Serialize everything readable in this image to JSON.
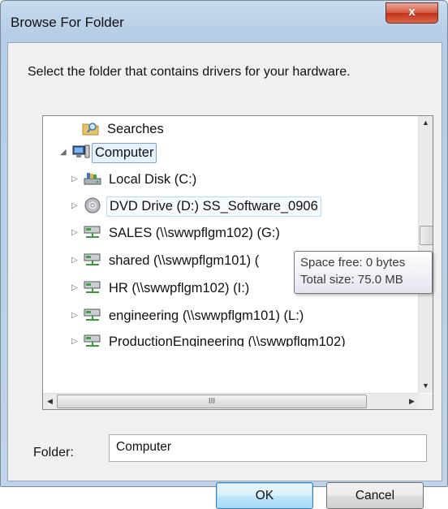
{
  "window": {
    "title": "Browse For Folder",
    "close_label": "x"
  },
  "instruction": "Select the folder that contains drivers for your hardware.",
  "tree": {
    "items": [
      {
        "label": "Searches",
        "icon": "folder-search-icon",
        "expander": "",
        "selected": false
      },
      {
        "label": "Computer",
        "icon": "computer-icon",
        "expander": "expanded",
        "selected": true
      },
      {
        "label": "Local Disk (C:)",
        "icon": "hard-disk-icon",
        "expander": "collapsed",
        "selected": false
      },
      {
        "label": "DVD Drive (D:) SS_Software_0906",
        "icon": "dvd-drive-icon",
        "expander": "collapsed",
        "selected": false,
        "hovered": true
      },
      {
        "label": "SALES (\\\\swwpflgm102) (G:)",
        "icon": "network-drive-icon",
        "expander": "collapsed",
        "selected": false
      },
      {
        "label": "shared (\\\\swwpflgm101) (",
        "icon": "network-drive-icon",
        "expander": "collapsed",
        "selected": false
      },
      {
        "label": "HR (\\\\swwpflgm102) (I:)",
        "icon": "network-drive-icon",
        "expander": "collapsed",
        "selected": false
      },
      {
        "label": "engineering (\\\\swwpflgm101) (L:)",
        "icon": "network-drive-icon",
        "expander": "collapsed",
        "selected": false
      },
      {
        "label": "ProductionEngineering (\\\\swwpflgm102)",
        "icon": "network-drive-icon",
        "expander": "collapsed",
        "selected": false
      }
    ]
  },
  "tooltip": {
    "line1": "Space free: 0 bytes",
    "line2": "Total size: 75.0 MB"
  },
  "scrollbar": {
    "hthumb_grip": "III"
  },
  "folder": {
    "label": "Folder:",
    "value": "Computer"
  },
  "buttons": {
    "ok": "OK",
    "cancel": "Cancel"
  }
}
